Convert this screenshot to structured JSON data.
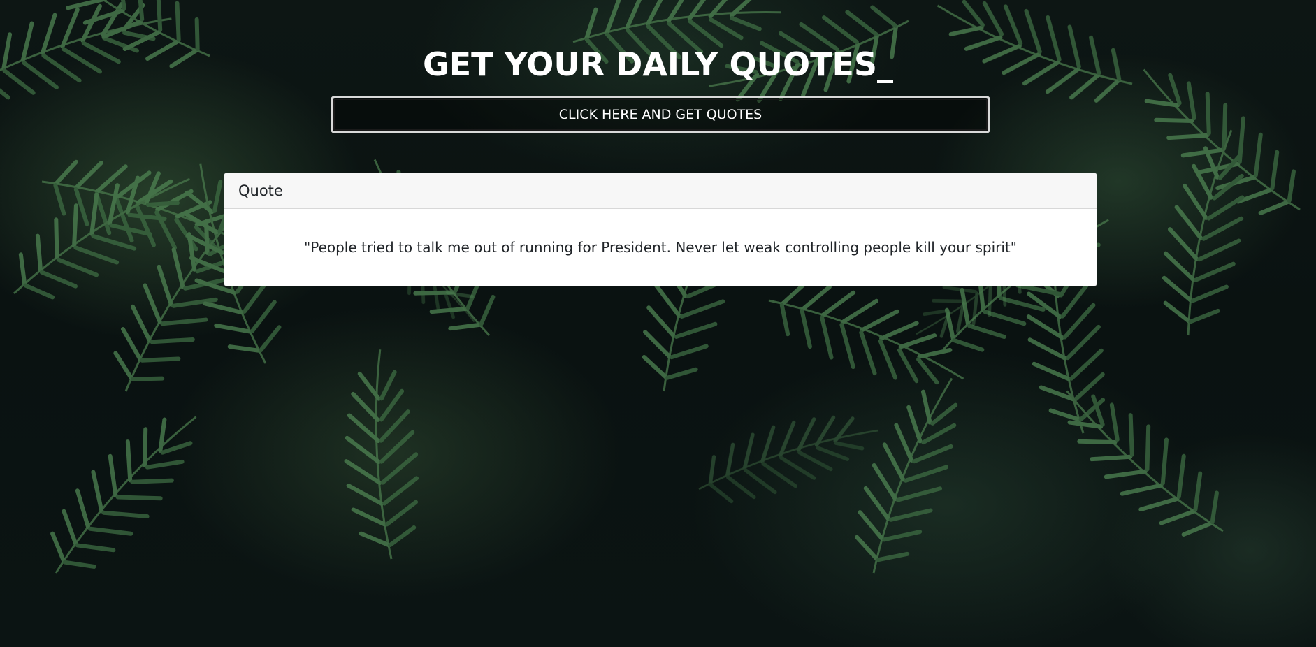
{
  "header": {
    "title": "GET YOUR DAILY QUOTES_"
  },
  "actions": {
    "get_quotes_label": "CLICK HERE AND GET QUOTES"
  },
  "quote_card": {
    "header_label": "Quote",
    "text": "\"People tried to talk me out of running for President. Never let weak controlling people kill your spirit\""
  },
  "colors": {
    "background": "#0b1210",
    "title_text": "#ffffff",
    "card_background": "#ffffff",
    "card_header_background": "#f7f7f7",
    "foliage": "#3d6a45"
  },
  "background_image": "palm-leaves-foliage"
}
